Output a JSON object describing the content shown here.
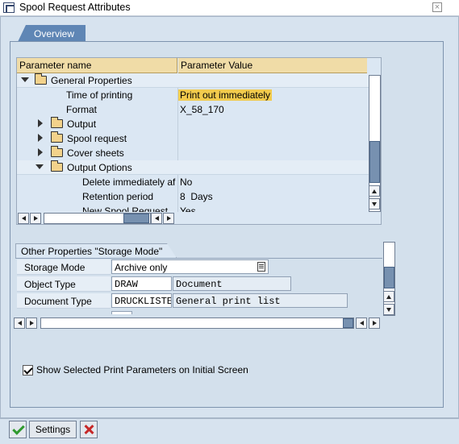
{
  "window": {
    "title": "Spool Request Attributes",
    "close_icon": "close-icon"
  },
  "tabs": [
    {
      "label": "Overview",
      "active": true
    }
  ],
  "tree": {
    "columns": [
      "Parameter name",
      "Parameter Value"
    ],
    "group": "General Properties",
    "rows": [
      {
        "name": "Time of printing",
        "value": "Print out immediately"
      },
      {
        "name": "Format",
        "value": "X_58_170"
      }
    ],
    "folders": [
      "Output",
      "Spool request",
      "Cover sheets",
      "Output Options"
    ],
    "output_options_rows": [
      {
        "name": "Delete immediately af",
        "value": "No"
      },
      {
        "name": "Retention period",
        "value": "8  Days"
      },
      {
        "name": "New Spool Request",
        "value": "Yes"
      }
    ]
  },
  "other_properties": {
    "title": "Other Properties \"Storage Mode\"",
    "storage_mode": {
      "label": "Storage Mode",
      "value": "Archive only"
    },
    "object_type": {
      "label": "Object Type",
      "code": "DRAW",
      "text": "Document"
    },
    "document_type": {
      "label": "Document Type",
      "code": "DRUCKLISTE",
      "text": "General print list"
    }
  },
  "show_params_checkbox": {
    "label": "Show Selected Print Parameters on Initial Screen",
    "checked": true
  },
  "footer": {
    "settings_label": "Settings"
  },
  "colors": {
    "frame_bg": "#d7e3ef",
    "tab_bg": "#5f86b5",
    "header_bg": "#f0dca7",
    "highlight": "#f2cb4d"
  }
}
